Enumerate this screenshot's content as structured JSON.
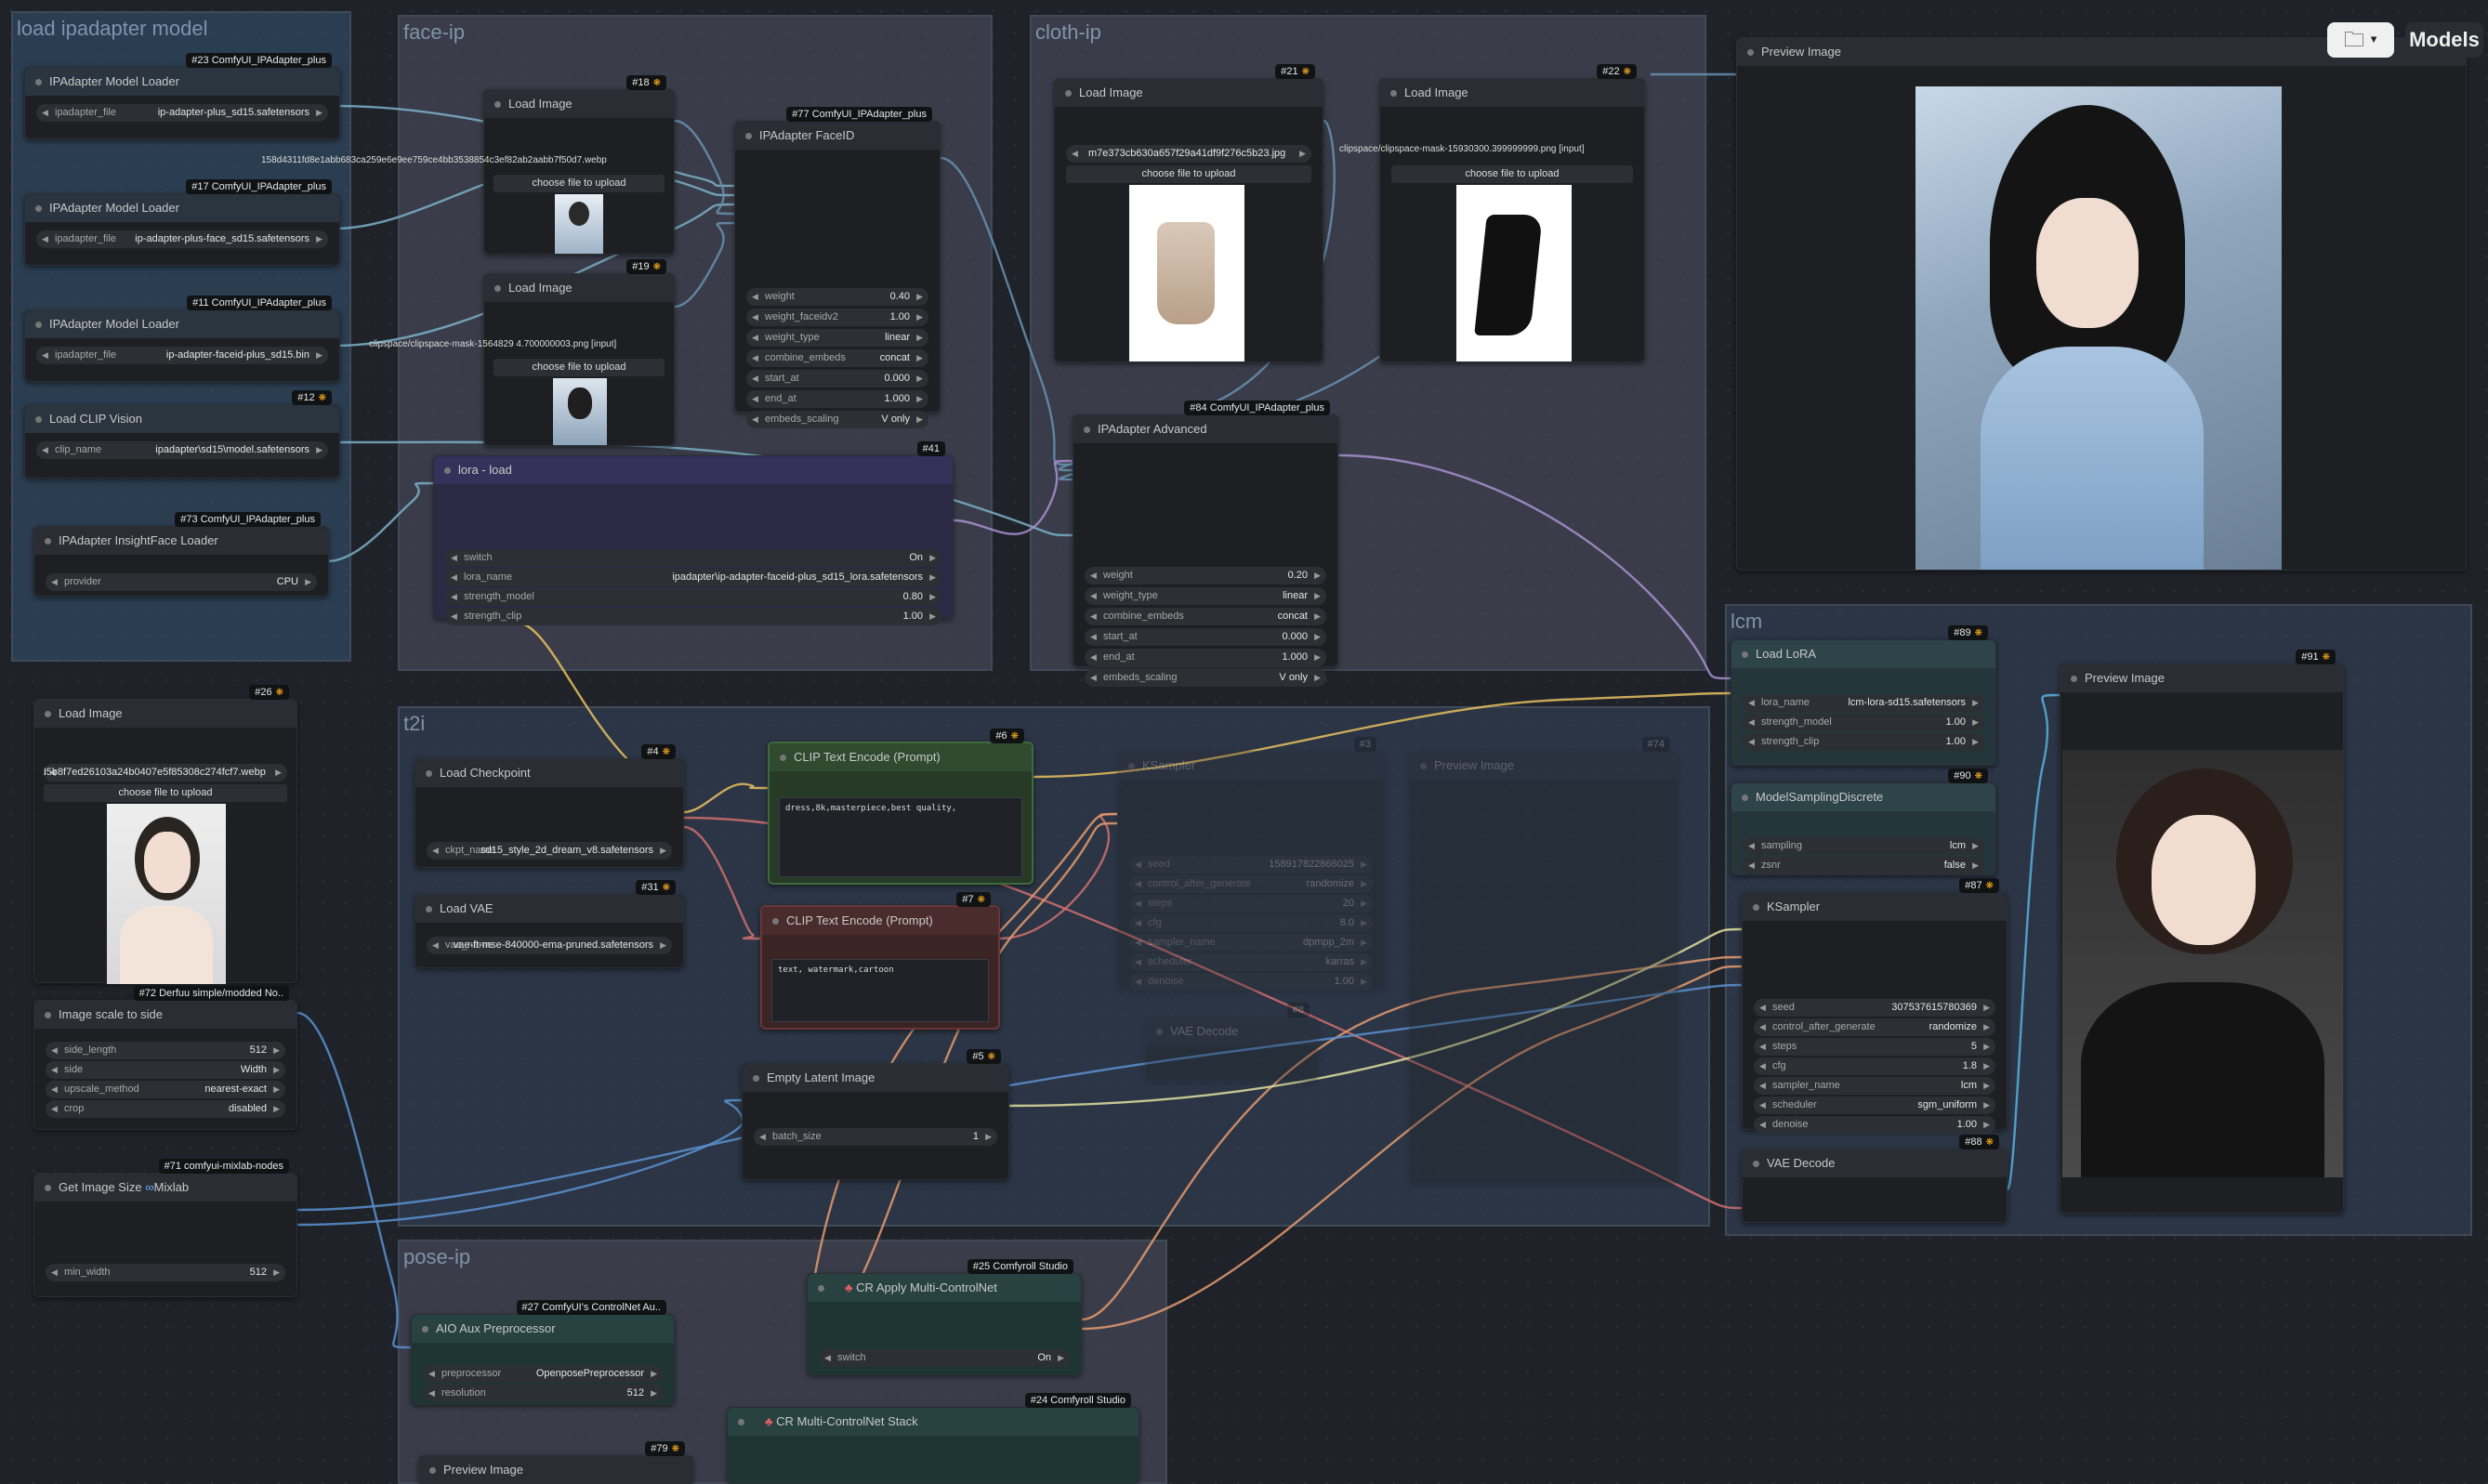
{
  "toolbar": {
    "folder_icon": "folder-icon",
    "models_label": "Models"
  },
  "groups": {
    "load_ipadapter": "load ipadapter model",
    "face_ip": "face-ip",
    "cloth_ip": "cloth-ip",
    "t2i": "t2i",
    "lcm": "lcm",
    "pose_ip": "pose-ip"
  },
  "nodes": {
    "ipa_loader_23": {
      "badge": "#23 ComfyUI_IPAdapter_plus",
      "title": "IPAdapter Model Loader",
      "w": [
        {
          "l": "ipadapter_file",
          "v": "ip-adapter-plus_sd15.safetensors"
        }
      ]
    },
    "ipa_loader_17": {
      "badge": "#17 ComfyUI_IPAdapter_plus",
      "title": "IPAdapter Model Loader",
      "w": [
        {
          "l": "ipadapter_file",
          "v": "ip-adapter-plus-face_sd15.safetensors"
        }
      ]
    },
    "ipa_loader_11": {
      "badge": "#11 ComfyUI_IPAdapter_plus",
      "title": "IPAdapter Model Loader",
      "w": [
        {
          "l": "ipadapter_file",
          "v": "ip-adapter-faceid-plus_sd15.bin"
        }
      ]
    },
    "clip_vision_12": {
      "badge": "#12",
      "title": "Load CLIP Vision",
      "w": [
        {
          "l": "clip_name",
          "v": "ipadapter\\sd15\\model.safetensors"
        }
      ]
    },
    "insightface_73": {
      "badge": "#73 ComfyUI_IPAdapter_plus",
      "title": "IPAdapter InsightFace Loader",
      "w": [
        {
          "l": "provider",
          "v": "CPU"
        }
      ]
    },
    "load_image_18": {
      "badge": "#18",
      "title": "Load Image",
      "file": "158d4311fd8e1abb683ca259e6e9ee759ce4bb3538854c3ef82ab2aabb7f50d7.webp",
      "btn": "choose file to upload"
    },
    "load_image_19": {
      "badge": "#19",
      "title": "Load Image",
      "file": "clipspace/clipspace-mask-1564829 4.700000003.png [input]",
      "btn": "choose file to upload"
    },
    "faceid_77": {
      "badge": "#77 ComfyUI_IPAdapter_plus",
      "title": "IPAdapter FaceID",
      "w": [
        {
          "l": "weight",
          "v": "0.40"
        },
        {
          "l": "weight_faceidv2",
          "v": "1.00"
        },
        {
          "l": "weight_type",
          "v": "linear"
        },
        {
          "l": "combine_embeds",
          "v": "concat"
        },
        {
          "l": "start_at",
          "v": "0.000"
        },
        {
          "l": "end_at",
          "v": "1.000"
        },
        {
          "l": "embeds_scaling",
          "v": "V only"
        }
      ]
    },
    "lora_41": {
      "badge": "#41",
      "title": "lora - load",
      "w": [
        {
          "l": "switch",
          "v": "On"
        },
        {
          "l": "lora_name",
          "v": "ipadapter\\ip-adapter-faceid-plus_sd15_lora.safetensors"
        },
        {
          "l": "strength_model",
          "v": "0.80"
        },
        {
          "l": "strength_clip",
          "v": "1.00"
        }
      ]
    },
    "load_image_21": {
      "badge": "#21",
      "title": "Load Image",
      "file": "m7e373cb630a657f29a41df9f276c5b23.jpg",
      "btn": "choose file to upload"
    },
    "load_image_22": {
      "badge": "#22",
      "title": "Load Image",
      "file": "clipspace/clipspace-mask-15930300.399999999.png [input]",
      "btn": "choose file to upload"
    },
    "ipa_adv_84": {
      "badge": "#84 ComfyUI_IPAdapter_plus",
      "title": "IPAdapter Advanced",
      "w": [
        {
          "l": "weight",
          "v": "0.20"
        },
        {
          "l": "weight_type",
          "v": "linear"
        },
        {
          "l": "combine_embeds",
          "v": "concat"
        },
        {
          "l": "start_at",
          "v": "0.000"
        },
        {
          "l": "end_at",
          "v": "1.000"
        },
        {
          "l": "embeds_scaling",
          "v": "V only"
        }
      ]
    },
    "preview_top": {
      "title": "Preview Image"
    },
    "load_image_26": {
      "badge": "#26",
      "title": "Load Image",
      "file": "e14aad5b8f7ed26103a24b0407e5f85308c274fcf7.webp",
      "btn": "choose file to upload"
    },
    "image_scale_72": {
      "badge": "#72 Derfuu simple/modded No..",
      "title": "Image scale to side",
      "w": [
        {
          "l": "side_length",
          "v": "512"
        },
        {
          "l": "side",
          "v": "Width"
        },
        {
          "l": "upscale_method",
          "v": "nearest-exact"
        },
        {
          "l": "crop",
          "v": "disabled"
        }
      ]
    },
    "image_size_71": {
      "badge": "#71 comfyui-mixlab-nodes",
      "title": "Get Image Size",
      "title_suffix": "Mixlab",
      "w": [
        {
          "l": "min_width",
          "v": "512"
        }
      ]
    },
    "ckpt_4": {
      "badge": "#4",
      "title": "Load Checkpoint",
      "w": [
        {
          "l": "ckpt_name",
          "v": "sd15_style_2d_dream_v8.safetensors"
        }
      ]
    },
    "vae_31": {
      "badge": "#31",
      "title": "Load VAE",
      "w": [
        {
          "l": "vae_name",
          "v": "vae-ft-mse-840000-ema-pruned.safetensors"
        }
      ]
    },
    "clip_pos_6": {
      "badge": "#6",
      "title": "CLIP Text Encode (Prompt)",
      "text": "dress,8k,masterpiece,best quality,"
    },
    "clip_neg_7": {
      "badge": "#7",
      "title": "CLIP Text Encode (Prompt)",
      "text": "text, watermark,cartoon"
    },
    "latent_5": {
      "badge": "#5",
      "title": "Empty Latent Image",
      "w": [
        {
          "l": "batch_size",
          "v": "1"
        }
      ]
    },
    "ksampler_3": {
      "badge": "#3",
      "title": "KSampler",
      "w": [
        {
          "l": "seed",
          "v": "158917822866025"
        },
        {
          "l": "control_after_generate",
          "v": "randomize"
        },
        {
          "l": "steps",
          "v": "20"
        },
        {
          "l": "cfg",
          "v": "8.0"
        },
        {
          "l": "sampler_name",
          "v": "dpmpp_2m"
        },
        {
          "l": "scheduler",
          "v": "karras"
        },
        {
          "l": "denoise",
          "v": "1.00"
        }
      ]
    },
    "vae_decode_8": {
      "badge": "#8",
      "title": "VAE Decode"
    },
    "preview_74": {
      "badge": "#74",
      "title": "Preview Image"
    },
    "lora_89": {
      "badge": "#89",
      "title": "Load LoRA",
      "w": [
        {
          "l": "lora_name",
          "v": "lcm-lora-sd15.safetensors"
        },
        {
          "l": "strength_model",
          "v": "1.00"
        },
        {
          "l": "strength_clip",
          "v": "1.00"
        }
      ]
    },
    "msd_90": {
      "badge": "#90",
      "title": "ModelSamplingDiscrete",
      "w": [
        {
          "l": "sampling",
          "v": "lcm"
        },
        {
          "l": "zsnr",
          "v": "false"
        }
      ]
    },
    "ksampler_87": {
      "badge": "#87",
      "title": "KSampler",
      "w": [
        {
          "l": "seed",
          "v": "307537615780369"
        },
        {
          "l": "control_after_generate",
          "v": "randomize"
        },
        {
          "l": "steps",
          "v": "5"
        },
        {
          "l": "cfg",
          "v": "1.8"
        },
        {
          "l": "sampler_name",
          "v": "lcm"
        },
        {
          "l": "scheduler",
          "v": "sgm_uniform"
        },
        {
          "l": "denoise",
          "v": "1.00"
        }
      ]
    },
    "vae_decode_88": {
      "badge": "#88",
      "title": "VAE Decode"
    },
    "preview_91": {
      "badge": "#91",
      "title": "Preview Image"
    },
    "aio_27": {
      "badge": "#27 ComfyUI's ControlNet Au..",
      "title": "AIO Aux Preprocessor",
      "w": [
        {
          "l": "preprocessor",
          "v": "OpenposePreprocessor"
        },
        {
          "l": "resolution",
          "v": "512"
        }
      ]
    },
    "cr_apply_25": {
      "badge": "#25 Comfyroll Studio",
      "title": "CR Apply Multi-ControlNet",
      "w": [
        {
          "l": "switch",
          "v": "On"
        }
      ]
    },
    "cr_stack_24": {
      "badge": "#24 Comfyroll Studio",
      "title": "CR Multi-ControlNet Stack"
    },
    "preview_79": {
      "badge": "#79",
      "title": "Preview Image"
    }
  }
}
